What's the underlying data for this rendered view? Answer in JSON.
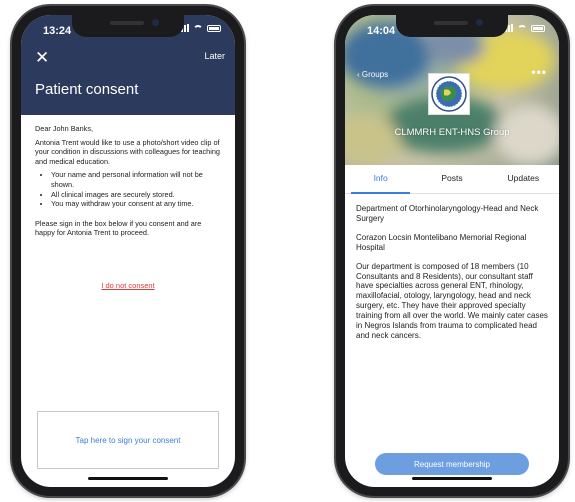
{
  "left_phone": {
    "status": {
      "time": "13:24"
    },
    "header": {
      "later_label": "Later",
      "title": "Patient consent"
    },
    "body": {
      "greeting": "Dear John Banks,",
      "intro": "Antonia Trent would like to use a photo/short video clip of your condition in discussions with colleagues for teaching and medical education.",
      "bullets": [
        "Your name and personal information will not be shown.",
        "All clinical images are securely stored.",
        "You may withdraw your consent at any time."
      ],
      "instruction": "Please sign in the box below if you consent and are happy for Antonia Trent to proceed."
    },
    "decline_link": "I do not consent",
    "sign_box_label": "Tap here to sign your consent",
    "icons": [
      "close-icon",
      "signal-icon",
      "wifi-icon",
      "battery-icon"
    ]
  },
  "right_phone": {
    "status": {
      "time": "14:04"
    },
    "header": {
      "back_label": "Groups",
      "more_label": "•••"
    },
    "group_name": "CLMMRH ENT-HNS Group",
    "tabs": [
      {
        "label": "Info",
        "active": true
      },
      {
        "label": "Posts",
        "active": false
      },
      {
        "label": "Updates",
        "active": false
      }
    ],
    "info": {
      "department": "Department of Otorhinolaryngology-Head and Neck Surgery",
      "hospital": "Corazon Locsin Montelibano Memorial Regional Hospital",
      "description": "Our department is composed of 18 members (10 Consultants and 8 Residents), our consultant staff have specialties across general ENT, rhinology, maxillofacial, otology, laryngology, head and neck surgery, etc. They have their approved specialty training from all over the world. We mainly cater cases in Negros Islands from trauma to complicated head and neck cancers."
    },
    "request_button": "Request membership",
    "icons": [
      "chevron-left-icon",
      "more-icon",
      "group-logo-icon"
    ]
  },
  "colors": {
    "navy_header": "#2c3a5e",
    "link_red": "#e03b3b",
    "accent_blue": "#3d7ed6",
    "button_blue": "#6d9ee0",
    "device_frame": "#1b1b1d"
  }
}
